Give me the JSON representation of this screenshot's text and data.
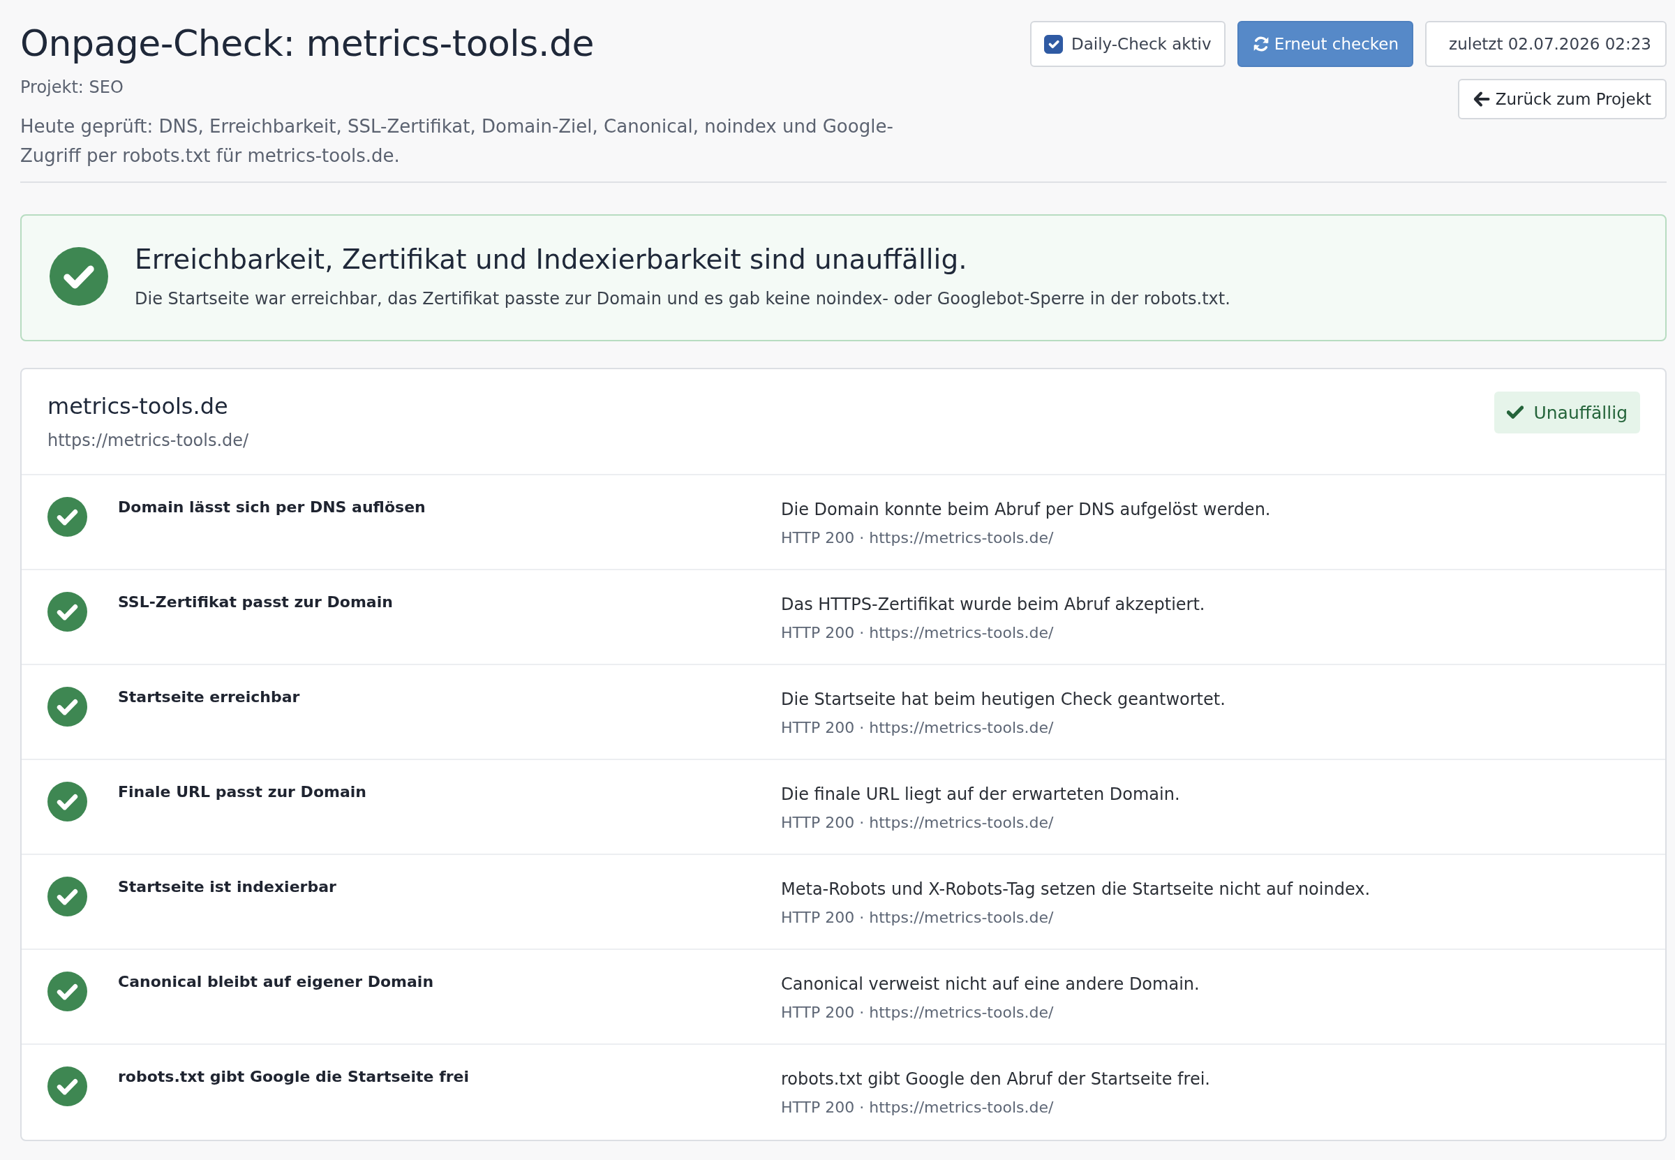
{
  "header": {
    "title": "Onpage-Check: metrics-tools.de",
    "project": "Projekt: SEO",
    "description": "Heute geprüft: DNS, Erreichbarkeit, SSL-Zertifikat, Domain-Ziel, Canonical, noindex und Google-Zugriff per robots.txt für metrics-tools.de."
  },
  "toolbar": {
    "daily_check": {
      "label": "Daily-Check aktiv",
      "checked": true
    },
    "recheck_button": "Erneut checken",
    "last_checked": "zuletzt 02.07.2026 02:23",
    "back_button": "Zurück zum Projekt"
  },
  "summary": {
    "passed": true,
    "title": "Erreichbarkeit, Zertifikat und Indexierbarkeit sind unauffällig.",
    "text": "Die Startseite war erreichbar, das Zertifikat passte zur Domain und es gab keine noindex- oder Googlebot-Sperre in der robots.txt."
  },
  "domain_card": {
    "domain": "metrics-tools.de",
    "url": "https://metrics-tools.de/",
    "status_badge": {
      "label": "Unauffällig",
      "passed": true
    },
    "checks": [
      {
        "title": "Domain lässt sich per DNS auflösen",
        "passed": true,
        "description": "Die Domain konnte beim Abruf per DNS aufgelöst werden.",
        "meta": "HTTP 200 · https://metrics-tools.de/"
      },
      {
        "title": "SSL-Zertifikat passt zur Domain",
        "passed": true,
        "description": "Das HTTPS-Zertifikat wurde beim Abruf akzeptiert.",
        "meta": "HTTP 200 · https://metrics-tools.de/"
      },
      {
        "title": "Startseite erreichbar",
        "passed": true,
        "description": "Die Startseite hat beim heutigen Check geantwortet.",
        "meta": "HTTP 200 · https://metrics-tools.de/"
      },
      {
        "title": "Finale URL passt zur Domain",
        "passed": true,
        "description": "Die finale URL liegt auf der erwarteten Domain.",
        "meta": "HTTP 200 · https://metrics-tools.de/"
      },
      {
        "title": "Startseite ist indexierbar",
        "passed": true,
        "description": "Meta-Robots und X-Robots-Tag setzen die Startseite nicht auf noindex.",
        "meta": "HTTP 200 · https://metrics-tools.de/"
      },
      {
        "title": "Canonical bleibt auf eigener Domain",
        "passed": true,
        "description": "Canonical verweist nicht auf eine andere Domain.",
        "meta": "HTTP 200 · https://metrics-tools.de/"
      },
      {
        "title": "robots.txt gibt Google die Startseite frei",
        "passed": true,
        "description": "robots.txt gibt Google den Abruf der Startseite frei.",
        "meta": "HTTP 200 · https://metrics-tools.de/"
      }
    ]
  }
}
